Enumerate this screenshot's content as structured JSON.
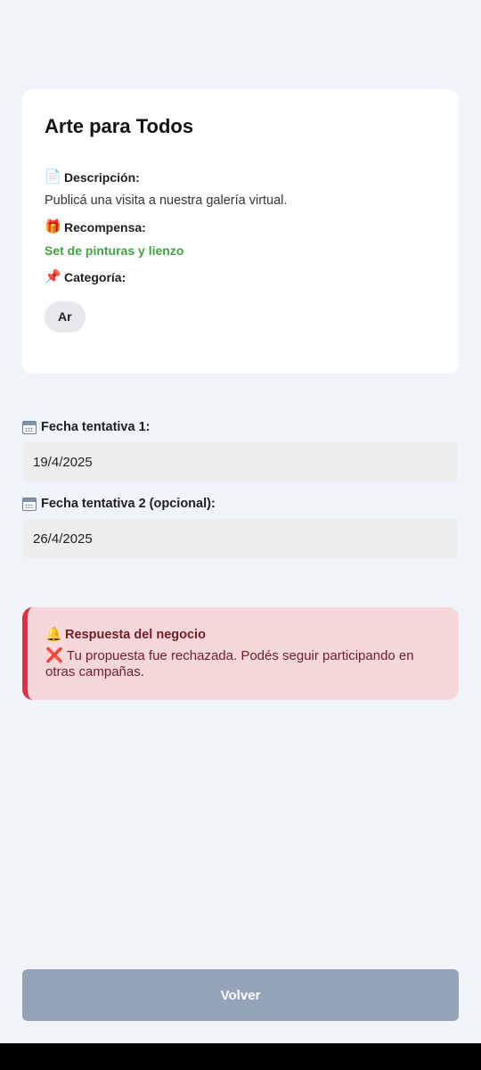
{
  "campaign": {
    "title": "Arte para Todos",
    "description_icon": "📄",
    "description_label": "Descripción:",
    "description": "Publicá una visita a nuestra galería virtual.",
    "reward_icon": "🎁",
    "reward_label": "Recompensa:",
    "reward": "Set de pinturas y lienzo",
    "category_icon": "📌",
    "category_label": "Categoría:",
    "category_chip": "Ar"
  },
  "dates": {
    "date1_label": "Fecha tentativa 1:",
    "date1_value": "19/4/2025",
    "date2_label": "Fecha tentativa 2 (opcional):",
    "date2_value": "26/4/2025",
    "icon": "calendar-icon"
  },
  "response": {
    "icon": "🔔",
    "title": "Respuesta del negocio",
    "mark": "❌",
    "message": "Tu propuesta fue rechazada. Podés seguir participando en otras campañas.",
    "accent_color": "#d63547",
    "background_color": "#f8d7da"
  },
  "actions": {
    "back_label": "Volver",
    "back_color": "#94a3b8"
  },
  "colors": {
    "reward_green": "#43a047",
    "page_background": "#f0f4f9"
  }
}
